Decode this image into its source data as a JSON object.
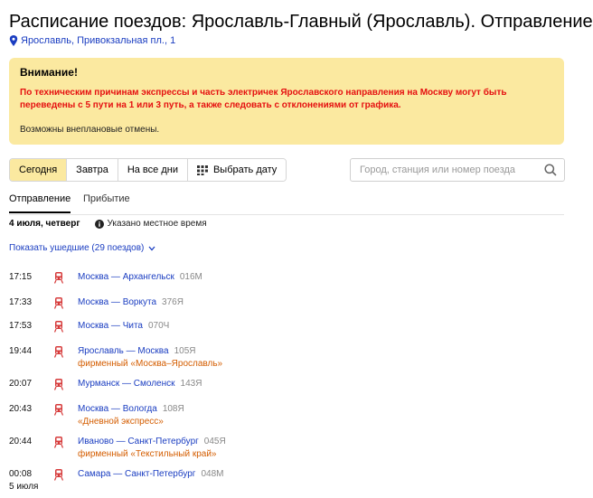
{
  "header": {
    "title": "Расписание поездов: Ярославль-Главный (Ярославль). Отправление",
    "address": "Ярославль, Привокзальная пл., 1"
  },
  "notice": {
    "title": "Внимание!",
    "warning": "По техническим причинам экспрессы и часть электричек Ярославского направления на Москву могут быть переведены с 5 пути на 1 или 3 путь, а также следовать с отклонениями от графика.",
    "note": "Возможны внеплановые отмены."
  },
  "day_filter": {
    "today": "Сегодня",
    "tomorrow": "Завтра",
    "all_days": "На все дни",
    "pick_date": "Выбрать дату"
  },
  "search": {
    "placeholder": "Город, станция или номер поезда"
  },
  "tabs": {
    "departure": "Отправление",
    "arrival": "Прибытие"
  },
  "date_line": {
    "date": "4 июля, четверг",
    "tz_note": "Указано местное время"
  },
  "show_past": "Показать ушедшие (29 поездов)",
  "trains": [
    {
      "time": "17:15",
      "date": "",
      "route": "Москва — Архангельск",
      "number": "016М",
      "brand": ""
    },
    {
      "time": "17:33",
      "date": "",
      "route": "Москва — Воркута",
      "number": "376Я",
      "brand": ""
    },
    {
      "time": "17:53",
      "date": "",
      "route": "Москва — Чита",
      "number": "070Ч",
      "brand": ""
    },
    {
      "time": "19:44",
      "date": "",
      "route": "Ярославль — Москва",
      "number": "105Я",
      "brand": "фирменный «Москва–Ярославль»"
    },
    {
      "time": "20:07",
      "date": "",
      "route": "Мурманск — Смоленск",
      "number": "143Я",
      "brand": ""
    },
    {
      "time": "20:43",
      "date": "",
      "route": "Москва — Вологда",
      "number": "108Я",
      "brand": "«Дневной экспресс»"
    },
    {
      "time": "20:44",
      "date": "",
      "route": "Иваново — Санкт-Петербург",
      "number": "045Я",
      "brand": "фирменный «Текстильный край»"
    },
    {
      "time": "00:08",
      "date": "5 июля",
      "route": "Самара — Санкт-Петербург",
      "number": "048М",
      "brand": ""
    }
  ],
  "colors": {
    "accent_yellow": "#fbe9a0",
    "link_blue": "#1a3dc1",
    "warning_red": "#e51010",
    "brand_orange": "#d45d00",
    "train_icon": "#d63a3a"
  }
}
